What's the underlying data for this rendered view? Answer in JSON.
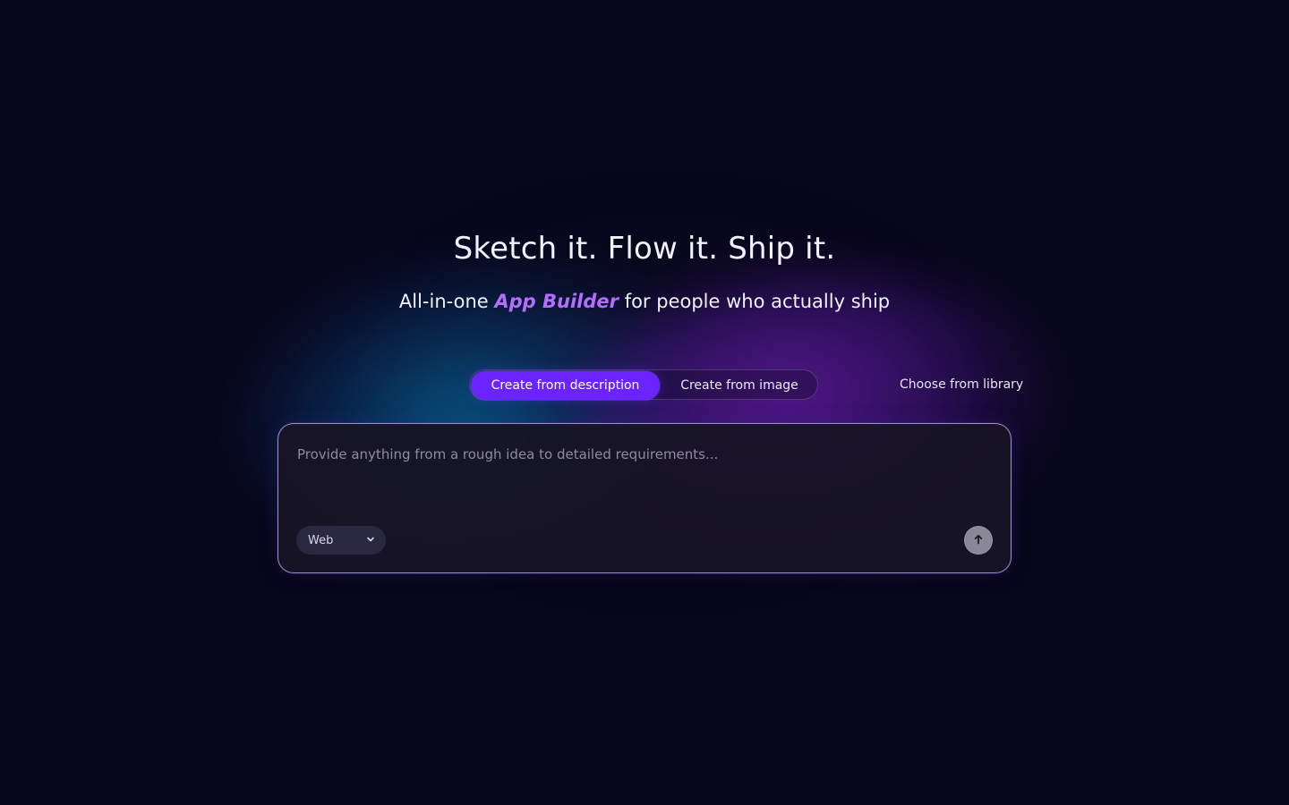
{
  "hero": {
    "title": "Sketch it. Flow it. Ship it.",
    "subtitle_prefix": "All-in-one",
    "subtitle_accent": "App Builder",
    "subtitle_suffix": "for people who actually ship"
  },
  "modes": {
    "active_label": "Create from description",
    "inactive_label": "Create from image"
  },
  "library": {
    "label": "Choose from library"
  },
  "composer": {
    "placeholder": "Provide anything from a rough idea to detailed requirements...",
    "value": "",
    "platform_value": "Web",
    "send_icon": "arrow-up-icon",
    "platform_icon": "chevron-down-icon"
  },
  "colors": {
    "background": "#07061a",
    "accent": "#b56cff",
    "button_active": "#6b24ff",
    "composer_background": "#171425",
    "send_button": "#8a8796"
  }
}
